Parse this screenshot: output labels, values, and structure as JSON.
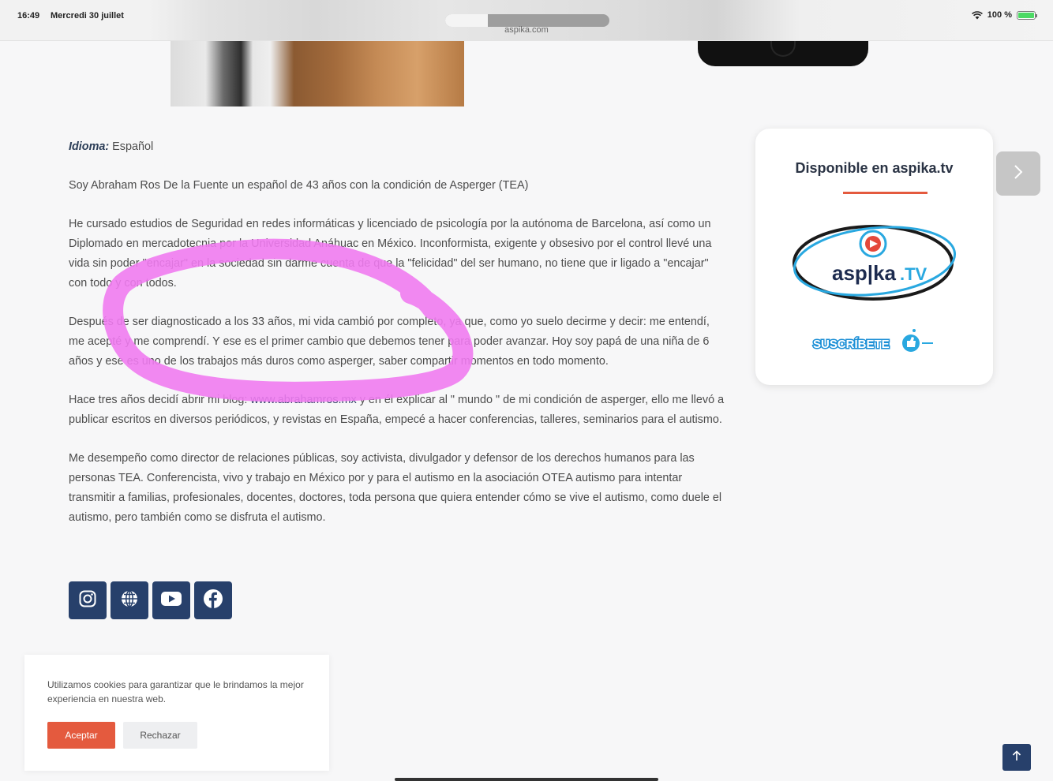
{
  "status_bar": {
    "time": "16:49",
    "date": "Mercredi 30 juillet",
    "url": "aspika.com",
    "battery": "100 %"
  },
  "article": {
    "language_label": "Idioma:",
    "language_value": "Español",
    "paragraph_1": "Soy Abraham Ros De la Fuente un español de 43 años con la condición de Asperger (TEA)",
    "paragraph_2": "He cursado estudios de Seguridad en redes informáticas y licenciado de psicología por la autónoma de Barcelona, así como un Diplomado en mercadotecnia por la Universidad Anáhuac en México. Inconformista, exigente y obsesivo por el control llevé una vida sin poder \"encajar\" en la sociedad sin darme cuenta de que la \"felicidad\" del ser humano, no tiene que ir ligado a \"encajar\" con todo y con todos.",
    "paragraph_3": "Después de ser diagnosticado a los 33 años, mi vida cambió por completo, ya que, como yo suelo decirme y decir: me entendí, me acepté y me comprendí. Y ese es el primer cambio que debemos tener para poder avanzar. Hoy soy papá de una niña de 6 años y ese es uno de los trabajos más duros como asperger, saber compartir momentos en todo momento.",
    "paragraph_4_before": "Hace tres años decidí abrir mi blog: ",
    "paragraph_4_link": "www.abrahamros.mx",
    "paragraph_4_after": " y en él explicar al \" mundo \" de mi condición de asperger, ello me llevó a publicar escritos en diversos periódicos, y revistas en España, empecé a hacer conferencias, talleres, seminarios para el autismo.",
    "paragraph_5": "Me desempeño como director de relaciones públicas, soy activista, divulgador y defensor de los derechos humanos para las personas TEA. Conferencista, vivo y trabajo en México por y para el autismo en la asociación OTEA autismo para intentar transmitir a familias, profesionales, docentes, doctores, toda persona que quiera entender cómo se vive el autismo, como duele el autismo, pero también como se disfruta el autismo."
  },
  "social": [
    "instagram-icon",
    "globe-icon",
    "youtube-icon",
    "facebook-icon"
  ],
  "widget": {
    "title": "Disponible en aspika.tv",
    "logo_text": "aspika.tv",
    "subscribe_text": "SUSCRÍBETE"
  },
  "cookie": {
    "text": "Utilizamos cookies para garantizar que le brindamos la mejor experiencia en nuestra web.",
    "accept": "Aceptar",
    "reject": "Rechazar"
  },
  "colors": {
    "accent": "#e45a3e",
    "navy": "#27406b",
    "marker": "#f07bf0"
  }
}
